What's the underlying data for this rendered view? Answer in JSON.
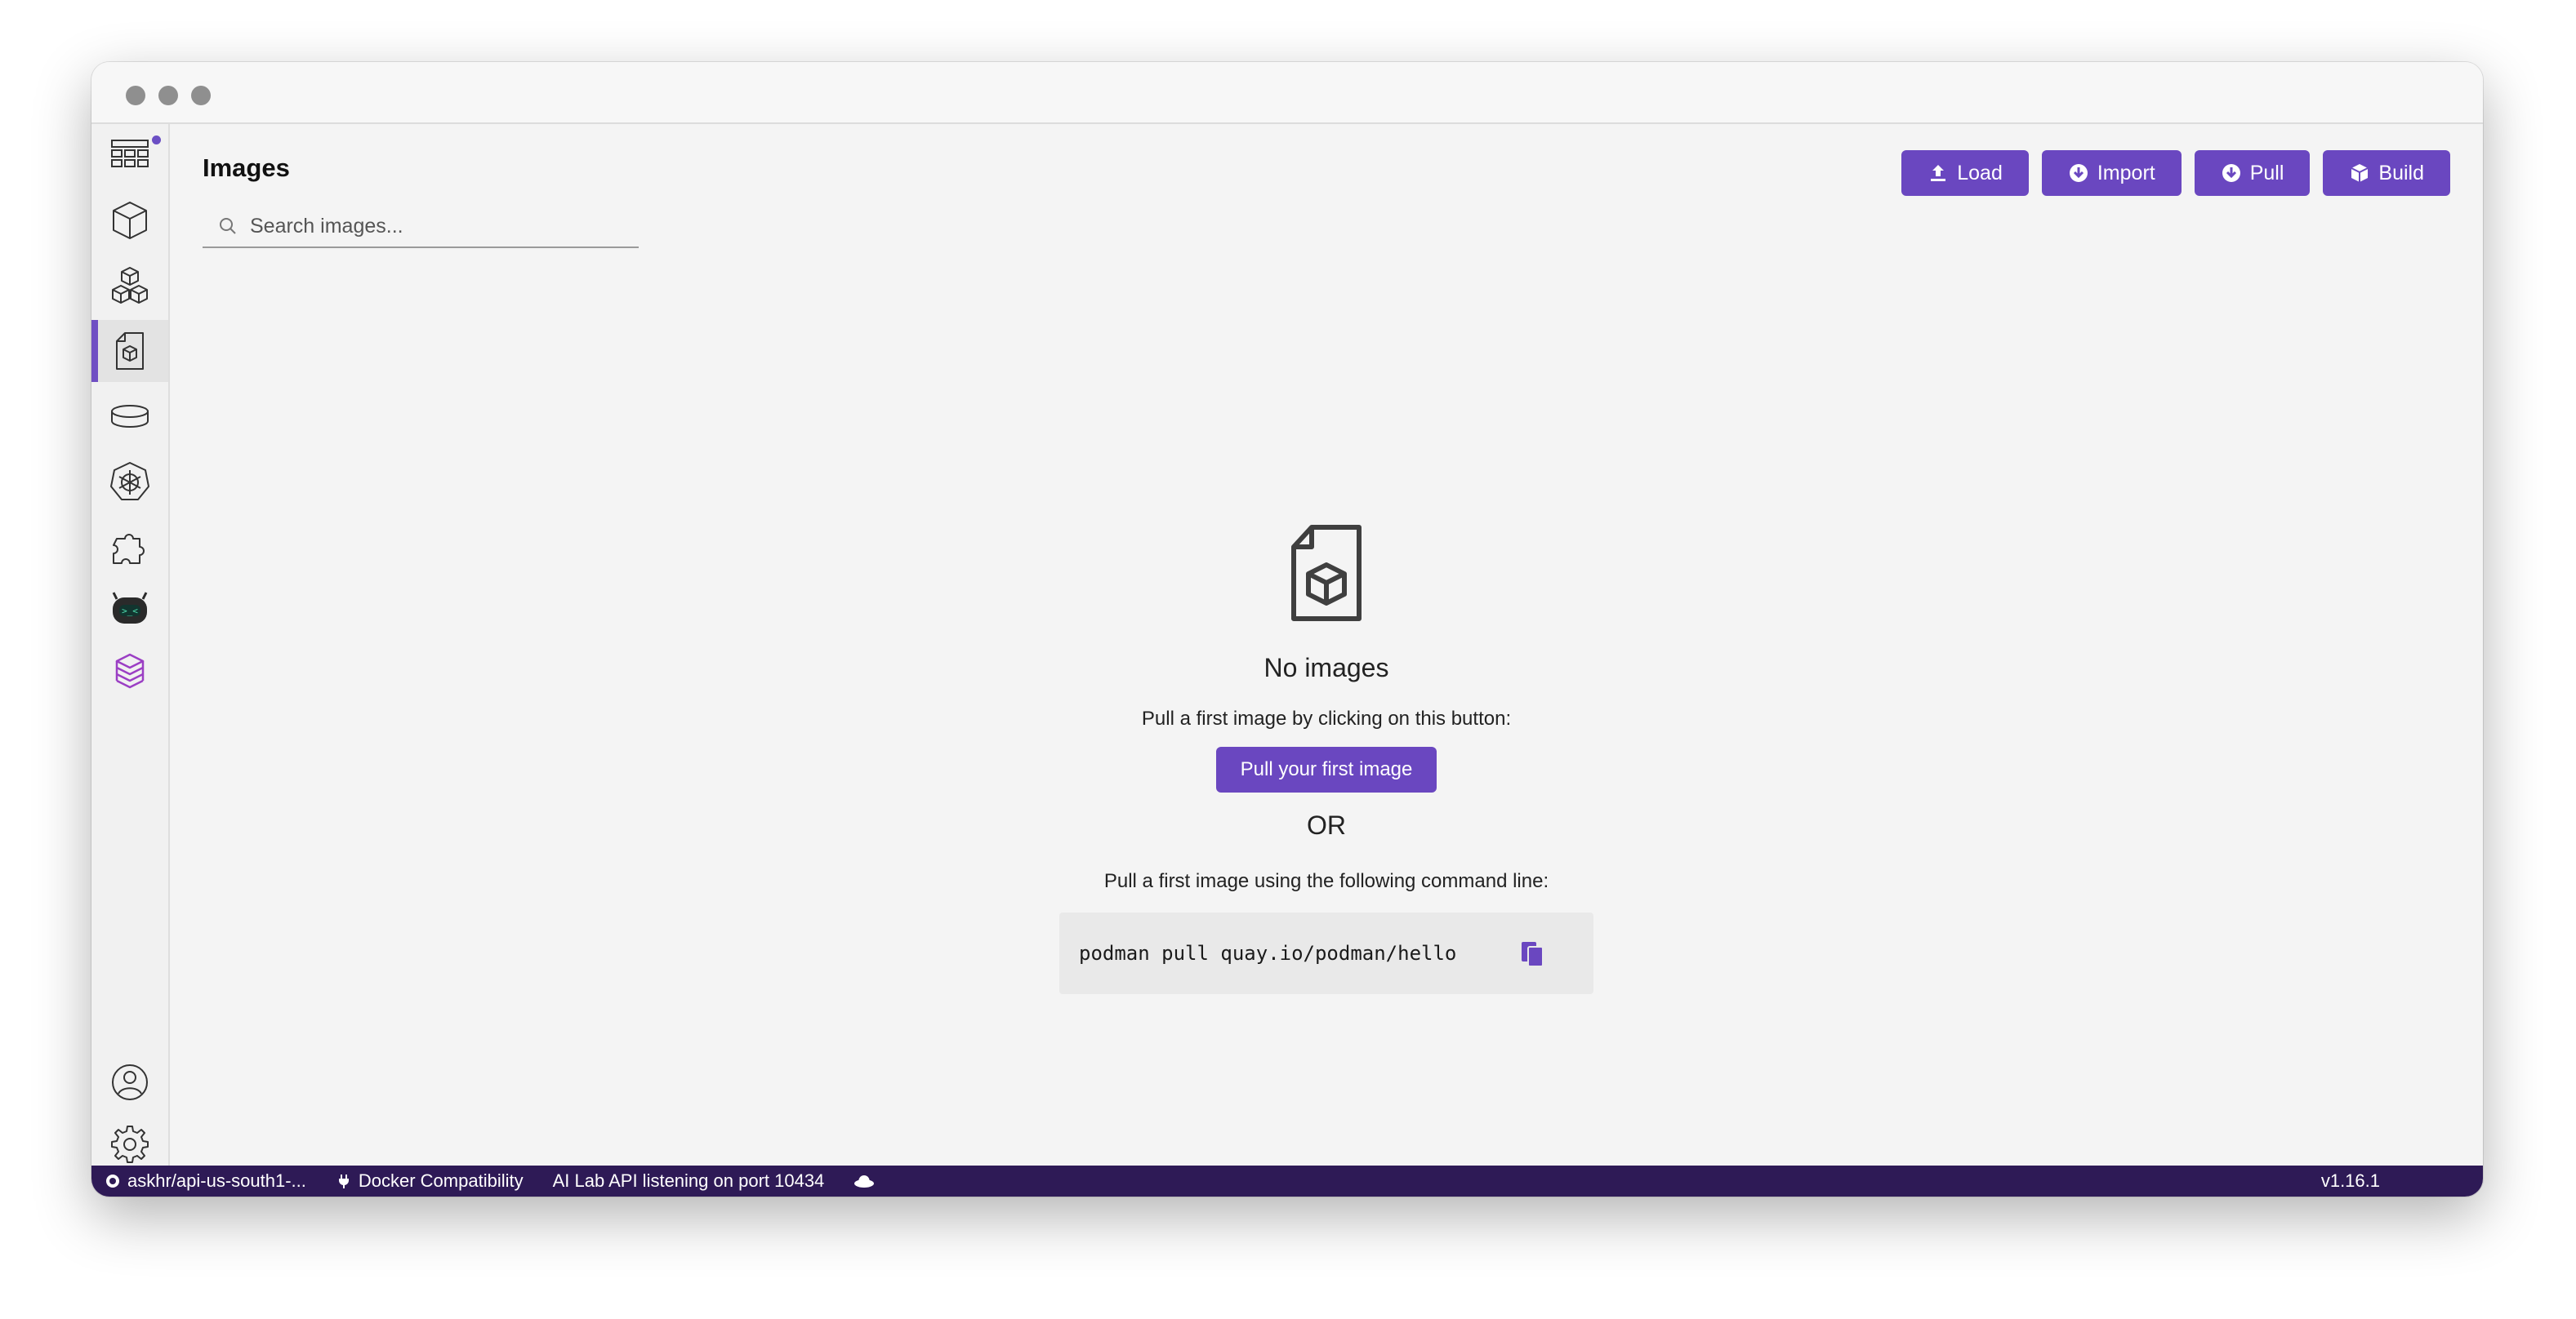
{
  "colors": {
    "accent": "#6a47c0",
    "statusbar": "#2e1a56",
    "background": "#f4f4f4"
  },
  "sidebar": {
    "items": [
      {
        "icon": "dashboard-icon"
      },
      {
        "icon": "containers-icon"
      },
      {
        "icon": "pods-icon"
      },
      {
        "icon": "images-icon",
        "active": true
      },
      {
        "icon": "volumes-icon"
      },
      {
        "icon": "kubernetes-icon"
      },
      {
        "icon": "extensions-icon"
      },
      {
        "icon": "bootc-icon"
      },
      {
        "icon": "ai-lab-icon"
      }
    ],
    "bottom": [
      {
        "icon": "account-icon"
      },
      {
        "icon": "settings-icon"
      }
    ]
  },
  "header": {
    "title": "Images"
  },
  "search": {
    "placeholder": "Search images..."
  },
  "toolbar": {
    "load": "Load",
    "import": "Import",
    "pull": "Pull",
    "build": "Build"
  },
  "empty_state": {
    "title": "No images",
    "pull_hint": "Pull a first image by clicking on this button:",
    "pull_button": "Pull your first image",
    "or": "OR",
    "cmd_hint": "Pull a first image using the following command line:",
    "command": "podman pull quay.io/podman/hello"
  },
  "statusbar": {
    "connection": "askhr/api-us-south1-...",
    "docker_compat": "Docker Compatibility",
    "ai_lab": "AI Lab API listening on port 10434",
    "version": "v1.16.1"
  }
}
